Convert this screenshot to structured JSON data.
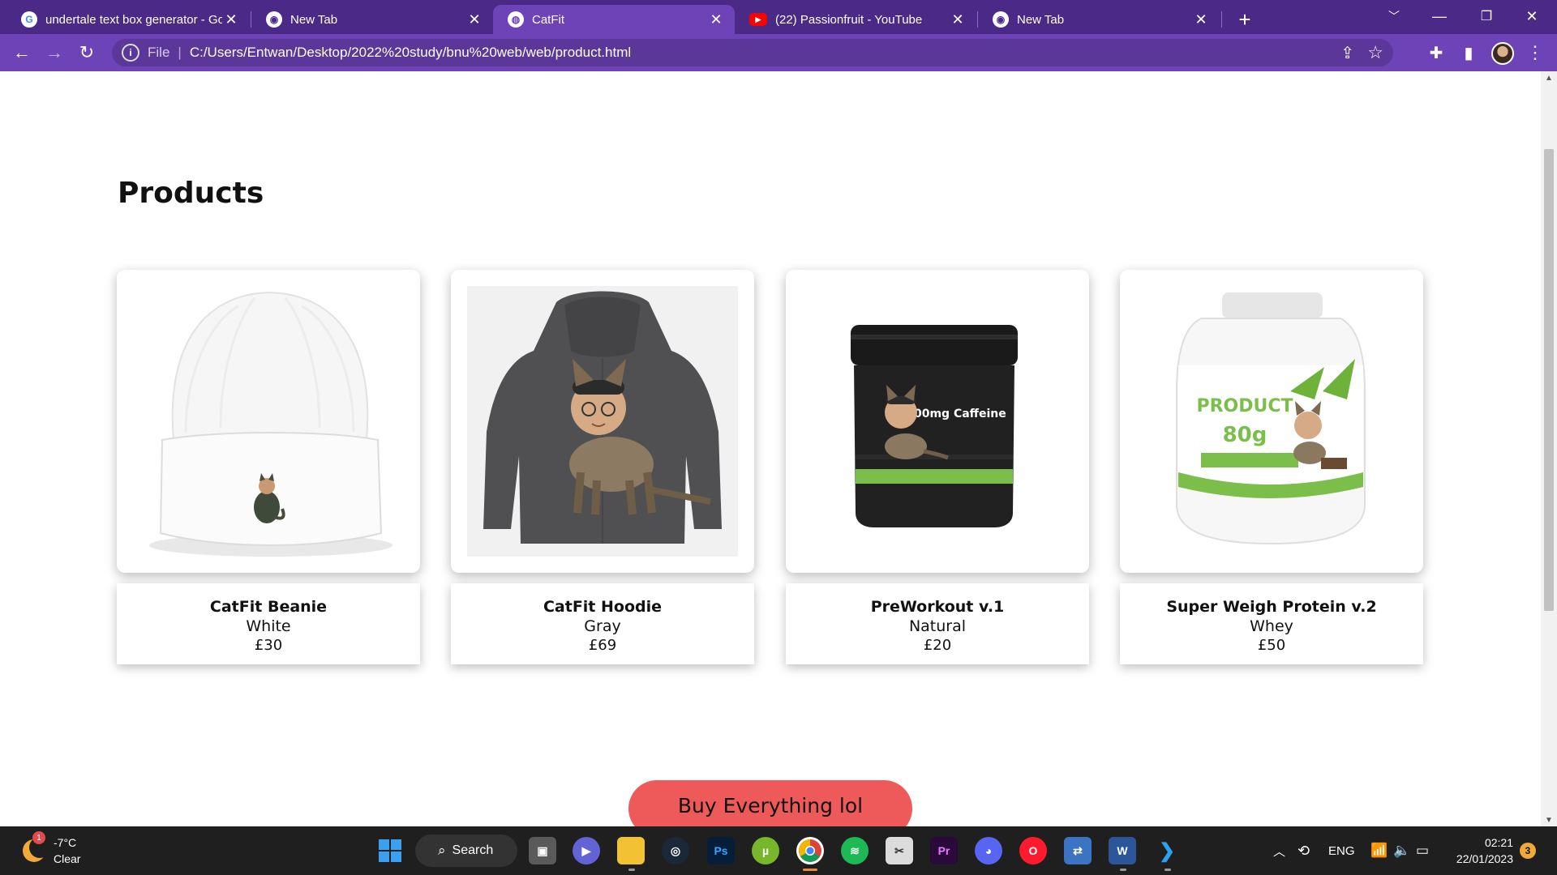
{
  "browser": {
    "tabs": [
      {
        "title": "undertale text box generator - Go",
        "icon": "google-icon"
      },
      {
        "title": "New Tab",
        "icon": "chrome-icon"
      },
      {
        "title": "CatFit",
        "icon": "globe-icon",
        "active": true
      },
      {
        "title": "(22) Passionfruit - YouTube",
        "icon": "youtube-icon"
      },
      {
        "title": "New Tab",
        "icon": "chrome-icon"
      }
    ],
    "address": {
      "scheme": "File",
      "url": "C:/Users/Entwan/Desktop/2022%20study/bnu%20web/web/product.html"
    },
    "theme_color": "#6e43b8"
  },
  "page": {
    "heading": "Products",
    "products": [
      {
        "name": "CatFit Beanie",
        "variant": "White",
        "price": "£30"
      },
      {
        "name": "CatFit Hoodie",
        "variant": "Gray",
        "price": "£69"
      },
      {
        "name": "PreWorkout v.1",
        "variant": "Natural",
        "price": "£20"
      },
      {
        "name": "Super Weigh Protein v.2",
        "variant": "Whey",
        "price": "£50"
      }
    ],
    "preworkout_label": "500mg Caffeine",
    "protein_label": {
      "line1": "PRODUCT",
      "line2": "80g"
    },
    "buy_button": "Buy Everything lol",
    "accent_color": "#ee5a5a"
  },
  "taskbar": {
    "weather": {
      "temp": "-7°C",
      "condition": "Clear",
      "badge": "1"
    },
    "search_label": "Search",
    "language": "ENG",
    "time": "02:21",
    "date": "22/01/2023",
    "notifications": "3"
  }
}
